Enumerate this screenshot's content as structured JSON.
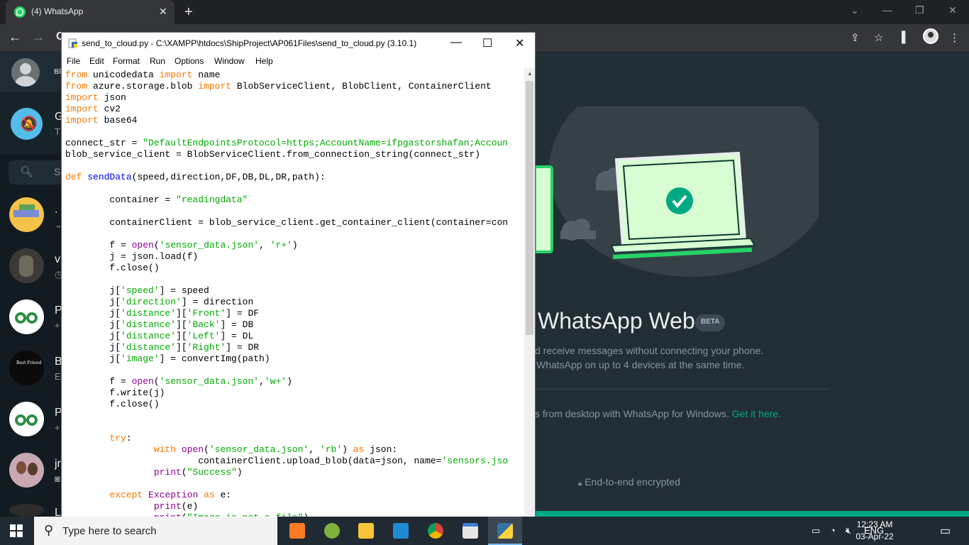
{
  "browser": {
    "tab_title": "(4) WhatsApp",
    "tab_close": "✕",
    "new_tab": "+",
    "back": "←",
    "forward": "→",
    "omnibox_partial": "C",
    "controls": {
      "dropdown": "⌄",
      "minimize": "—",
      "restore": "❐",
      "close": "✕"
    }
  },
  "whatsapp": {
    "search_partial": "S",
    "chats": [
      {
        "letter": ".",
        "sub": "⌄"
      },
      {
        "letter": "v",
        "sub": "◷"
      },
      {
        "letter": "P",
        "sub": "+"
      },
      {
        "letter": "B",
        "sub": "E"
      },
      {
        "letter": "P",
        "sub": "+"
      },
      {
        "letter": "jr",
        "sub": "◙"
      },
      {
        "letter": "L",
        "sub": ""
      }
    ],
    "title": "WhatsApp Web",
    "beta": "BETA",
    "line1": "d receive messages without connecting your phone.",
    "line2": "WhatsApp on up to 4 devices at the same time.",
    "line3_prefix": "s from desktop with WhatsApp for Windows.",
    "line3_link": "Get it here.",
    "encrypted": "End-to-end encrypted",
    "colors": {
      "accent": "#00a884",
      "panel": "#222e35"
    }
  },
  "idle": {
    "title": "send_to_cloud.py - C:\\XAMPP\\htdocs\\ShipProject\\AP061Files\\send_to_cloud.py (3.10.1)",
    "controls": {
      "minimize": "—",
      "maximize": "☐",
      "close": "✕"
    },
    "menu": [
      "File",
      "Edit",
      "Format",
      "Run",
      "Options",
      "Window",
      "Help"
    ],
    "code": [
      [
        [
          "kw",
          "from"
        ],
        [
          "",
          " unicodedata "
        ],
        [
          "kw",
          "import"
        ],
        [
          "",
          " name"
        ]
      ],
      [
        [
          "kw",
          "from"
        ],
        [
          "",
          " azure.storage.blob "
        ],
        [
          "kw",
          "import"
        ],
        [
          "",
          " BlobServiceClient, BlobClient, ContainerClient"
        ]
      ],
      [
        [
          "kw",
          "import"
        ],
        [
          "",
          " json"
        ]
      ],
      [
        [
          "kw",
          "import"
        ],
        [
          "",
          " cv2"
        ]
      ],
      [
        [
          "kw",
          "import"
        ],
        [
          "",
          " base64"
        ]
      ],
      [
        [
          "",
          ""
        ]
      ],
      [
        [
          "",
          "connect_str = "
        ],
        [
          "st",
          "\"DefaultEndpointsProtocol=https;AccountName=ifpgastorshafan;Accoun"
        ]
      ],
      [
        [
          "",
          "blob_service_client = BlobServiceClient.from_connection_string(connect_str)"
        ]
      ],
      [
        [
          "",
          ""
        ]
      ],
      [
        [
          "kw",
          "def"
        ],
        [
          "",
          " "
        ],
        [
          "fn",
          "sendData"
        ],
        [
          "",
          "(speed,direction,DF,DB,DL,DR,path):"
        ]
      ],
      [
        [
          "",
          ""
        ]
      ],
      [
        [
          "",
          "        container = "
        ],
        [
          "st",
          "\"readingdata\""
        ]
      ],
      [
        [
          "",
          ""
        ]
      ],
      [
        [
          "",
          "        containerClient = blob_service_client.get_container_client(container=con"
        ]
      ],
      [
        [
          "",
          ""
        ]
      ],
      [
        [
          "",
          "        f = "
        ],
        [
          "bi",
          "open"
        ],
        [
          "",
          "("
        ],
        [
          "st",
          "'sensor_data.json'"
        ],
        [
          "",
          ", "
        ],
        [
          "st",
          "'r+'"
        ],
        [
          "",
          ")"
        ]
      ],
      [
        [
          "",
          "        j = json.load(f)"
        ]
      ],
      [
        [
          "",
          "        f.close()"
        ]
      ],
      [
        [
          "",
          ""
        ]
      ],
      [
        [
          "",
          "        j["
        ],
        [
          "st",
          "'speed'"
        ],
        [
          "",
          "] = speed"
        ]
      ],
      [
        [
          "",
          "        j["
        ],
        [
          "st",
          "'direction'"
        ],
        [
          "",
          "] = direction"
        ]
      ],
      [
        [
          "",
          "        j["
        ],
        [
          "st",
          "'distance'"
        ],
        [
          "",
          "]["
        ],
        [
          "st",
          "'Front'"
        ],
        [
          "",
          "] = DF"
        ]
      ],
      [
        [
          "",
          "        j["
        ],
        [
          "st",
          "'distance'"
        ],
        [
          "",
          "]["
        ],
        [
          "st",
          "'Back'"
        ],
        [
          "",
          "] = DB"
        ]
      ],
      [
        [
          "",
          "        j["
        ],
        [
          "st",
          "'distance'"
        ],
        [
          "",
          "]["
        ],
        [
          "st",
          "'Left'"
        ],
        [
          "",
          "] = DL"
        ]
      ],
      [
        [
          "",
          "        j["
        ],
        [
          "st",
          "'distance'"
        ],
        [
          "",
          "]["
        ],
        [
          "st",
          "'Right'"
        ],
        [
          "",
          "] = DR"
        ]
      ],
      [
        [
          "",
          "        j["
        ],
        [
          "st",
          "'image'"
        ],
        [
          "",
          "] = convertImg(path)"
        ]
      ],
      [
        [
          "",
          ""
        ]
      ],
      [
        [
          "",
          "        f = "
        ],
        [
          "bi",
          "open"
        ],
        [
          "",
          "("
        ],
        [
          "st",
          "'sensor_data.json'"
        ],
        [
          "",
          ","
        ],
        [
          "st",
          "'w+'"
        ],
        [
          "",
          ")"
        ]
      ],
      [
        [
          "",
          "        f.write(j)"
        ]
      ],
      [
        [
          "",
          "        f.close()"
        ]
      ],
      [
        [
          "",
          ""
        ]
      ],
      [
        [
          "",
          ""
        ]
      ],
      [
        [
          "",
          "        "
        ],
        [
          "kw",
          "try"
        ],
        [
          "",
          ":"
        ]
      ],
      [
        [
          "",
          "                "
        ],
        [
          "kw",
          "with"
        ],
        [
          "",
          " "
        ],
        [
          "bi",
          "open"
        ],
        [
          "",
          "("
        ],
        [
          "st",
          "'sensor_data.json'"
        ],
        [
          "",
          ", "
        ],
        [
          "st",
          "'rb'"
        ],
        [
          "",
          ") "
        ],
        [
          "kw",
          "as"
        ],
        [
          "",
          " json:"
        ]
      ],
      [
        [
          "",
          "                        containerClient.upload_blob(data=json, name="
        ],
        [
          "st",
          "'sensors.jso"
        ]
      ],
      [
        [
          "",
          "                "
        ],
        [
          "bi",
          "print"
        ],
        [
          "",
          "("
        ],
        [
          "st",
          "\"Success\""
        ],
        [
          "",
          ")"
        ]
      ],
      [
        [
          "",
          ""
        ]
      ],
      [
        [
          "",
          "        "
        ],
        [
          "kw",
          "except"
        ],
        [
          "",
          " "
        ],
        [
          "bi",
          "Exception"
        ],
        [
          "",
          " "
        ],
        [
          "kw",
          "as"
        ],
        [
          "",
          " e:"
        ]
      ],
      [
        [
          "",
          "                "
        ],
        [
          "bi",
          "print"
        ],
        [
          "",
          "(e)"
        ]
      ],
      [
        [
          "",
          "                "
        ],
        [
          "bi",
          "print"
        ],
        [
          "",
          "("
        ],
        [
          "st",
          "\"Image is not a file\""
        ],
        [
          "",
          ")"
        ]
      ]
    ]
  },
  "taskbar": {
    "search_placeholder": "Type here to search",
    "language": "ENG",
    "time": "12:23 AM",
    "date": "03-Apr-22",
    "apps": [
      "xampp",
      "eclipse",
      "file-explorer",
      "vscode",
      "chrome",
      "app-window",
      "python-idle"
    ]
  }
}
